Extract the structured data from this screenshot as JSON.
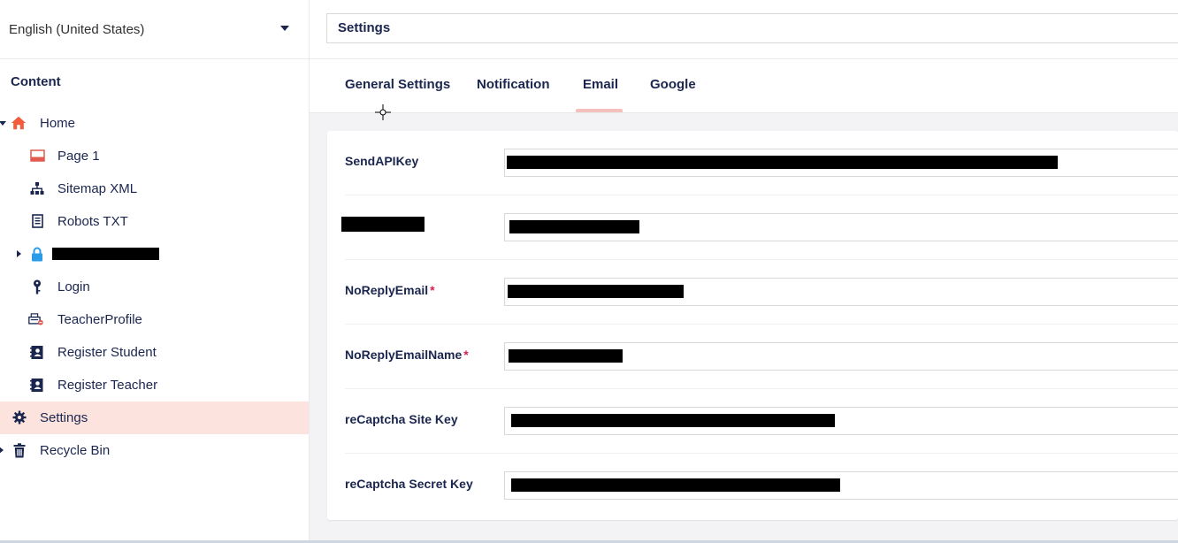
{
  "sidebar": {
    "language": "English (United States)",
    "section_title": "Content",
    "items": [
      {
        "label": "Home",
        "icon": "home-icon"
      },
      {
        "label": "Page 1",
        "icon": "page-icon"
      },
      {
        "label": "Sitemap XML",
        "icon": "sitemap-icon"
      },
      {
        "label": "Robots TXT",
        "icon": "document-icon"
      },
      {
        "label": "",
        "icon": "lock-icon"
      },
      {
        "label": "Login",
        "icon": "key-icon"
      },
      {
        "label": "TeacherProfile",
        "icon": "profile-icon"
      },
      {
        "label": "Register Student",
        "icon": "contact-book-icon"
      },
      {
        "label": "Register Teacher",
        "icon": "contact-book-icon"
      },
      {
        "label": "Settings",
        "icon": "gear-icon"
      },
      {
        "label": "Recycle Bin",
        "icon": "trash-icon"
      }
    ]
  },
  "header": {
    "title": "Settings"
  },
  "tabs": [
    {
      "label": "General Settings"
    },
    {
      "label": "Notification"
    },
    {
      "label": "Email"
    },
    {
      "label": "Google"
    }
  ],
  "active_tab": "Email",
  "properties": [
    {
      "label": "SendAPIKey",
      "required": false,
      "value": ""
    },
    {
      "label": "",
      "required": false,
      "value": ""
    },
    {
      "label": "NoReplyEmail",
      "required": true,
      "value": ""
    },
    {
      "label": "NoReplyEmailName",
      "required": true,
      "value": ""
    },
    {
      "label": "reCaptcha Site Key",
      "required": false,
      "value": ""
    },
    {
      "label": "reCaptcha Secret Key",
      "required": false,
      "value": ""
    }
  ],
  "required_marker": "*",
  "colors": {
    "accent": "#f5c1bc",
    "active_bg": "#fde3de",
    "home_icon": "#f25c3c",
    "page_icon": "#e05a4f",
    "lock_icon": "#2b9be8",
    "text": "#1b264f",
    "required": "#d42054"
  }
}
